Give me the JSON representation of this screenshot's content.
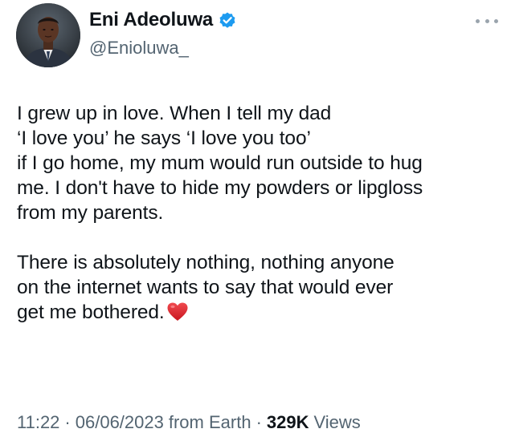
{
  "author": {
    "display_name": "Eni Adeoluwa",
    "handle": "@Enioluwa_",
    "verified_icon": "verified-badge-icon",
    "avatar": "profile-photo"
  },
  "menu": {
    "icon": "more-options-icon"
  },
  "tweet": {
    "lines": [
      "I grew up in love. When I tell my dad",
      "‘I love you’ he says ‘I love you too’",
      "if I go home, my mum would run outside to hug",
      "me. I don't have to hide my powders or lipgloss",
      "from my parents.",
      "",
      "There is absolutely nothing, nothing anyone",
      "on the internet wants to say that would ever",
      "get me bothered."
    ],
    "emoji": "red-heart-icon"
  },
  "meta": {
    "time": "11:22",
    "separator1": "·",
    "date": "06/06/2023",
    "source": "from Earth",
    "separator2": "·",
    "views_count": "329K",
    "views_label": "Views"
  },
  "colors": {
    "verified_blue": "#1d9bf0",
    "secondary_text": "#536471",
    "primary_text": "#0f1419",
    "heart_red": "#e0242f"
  }
}
